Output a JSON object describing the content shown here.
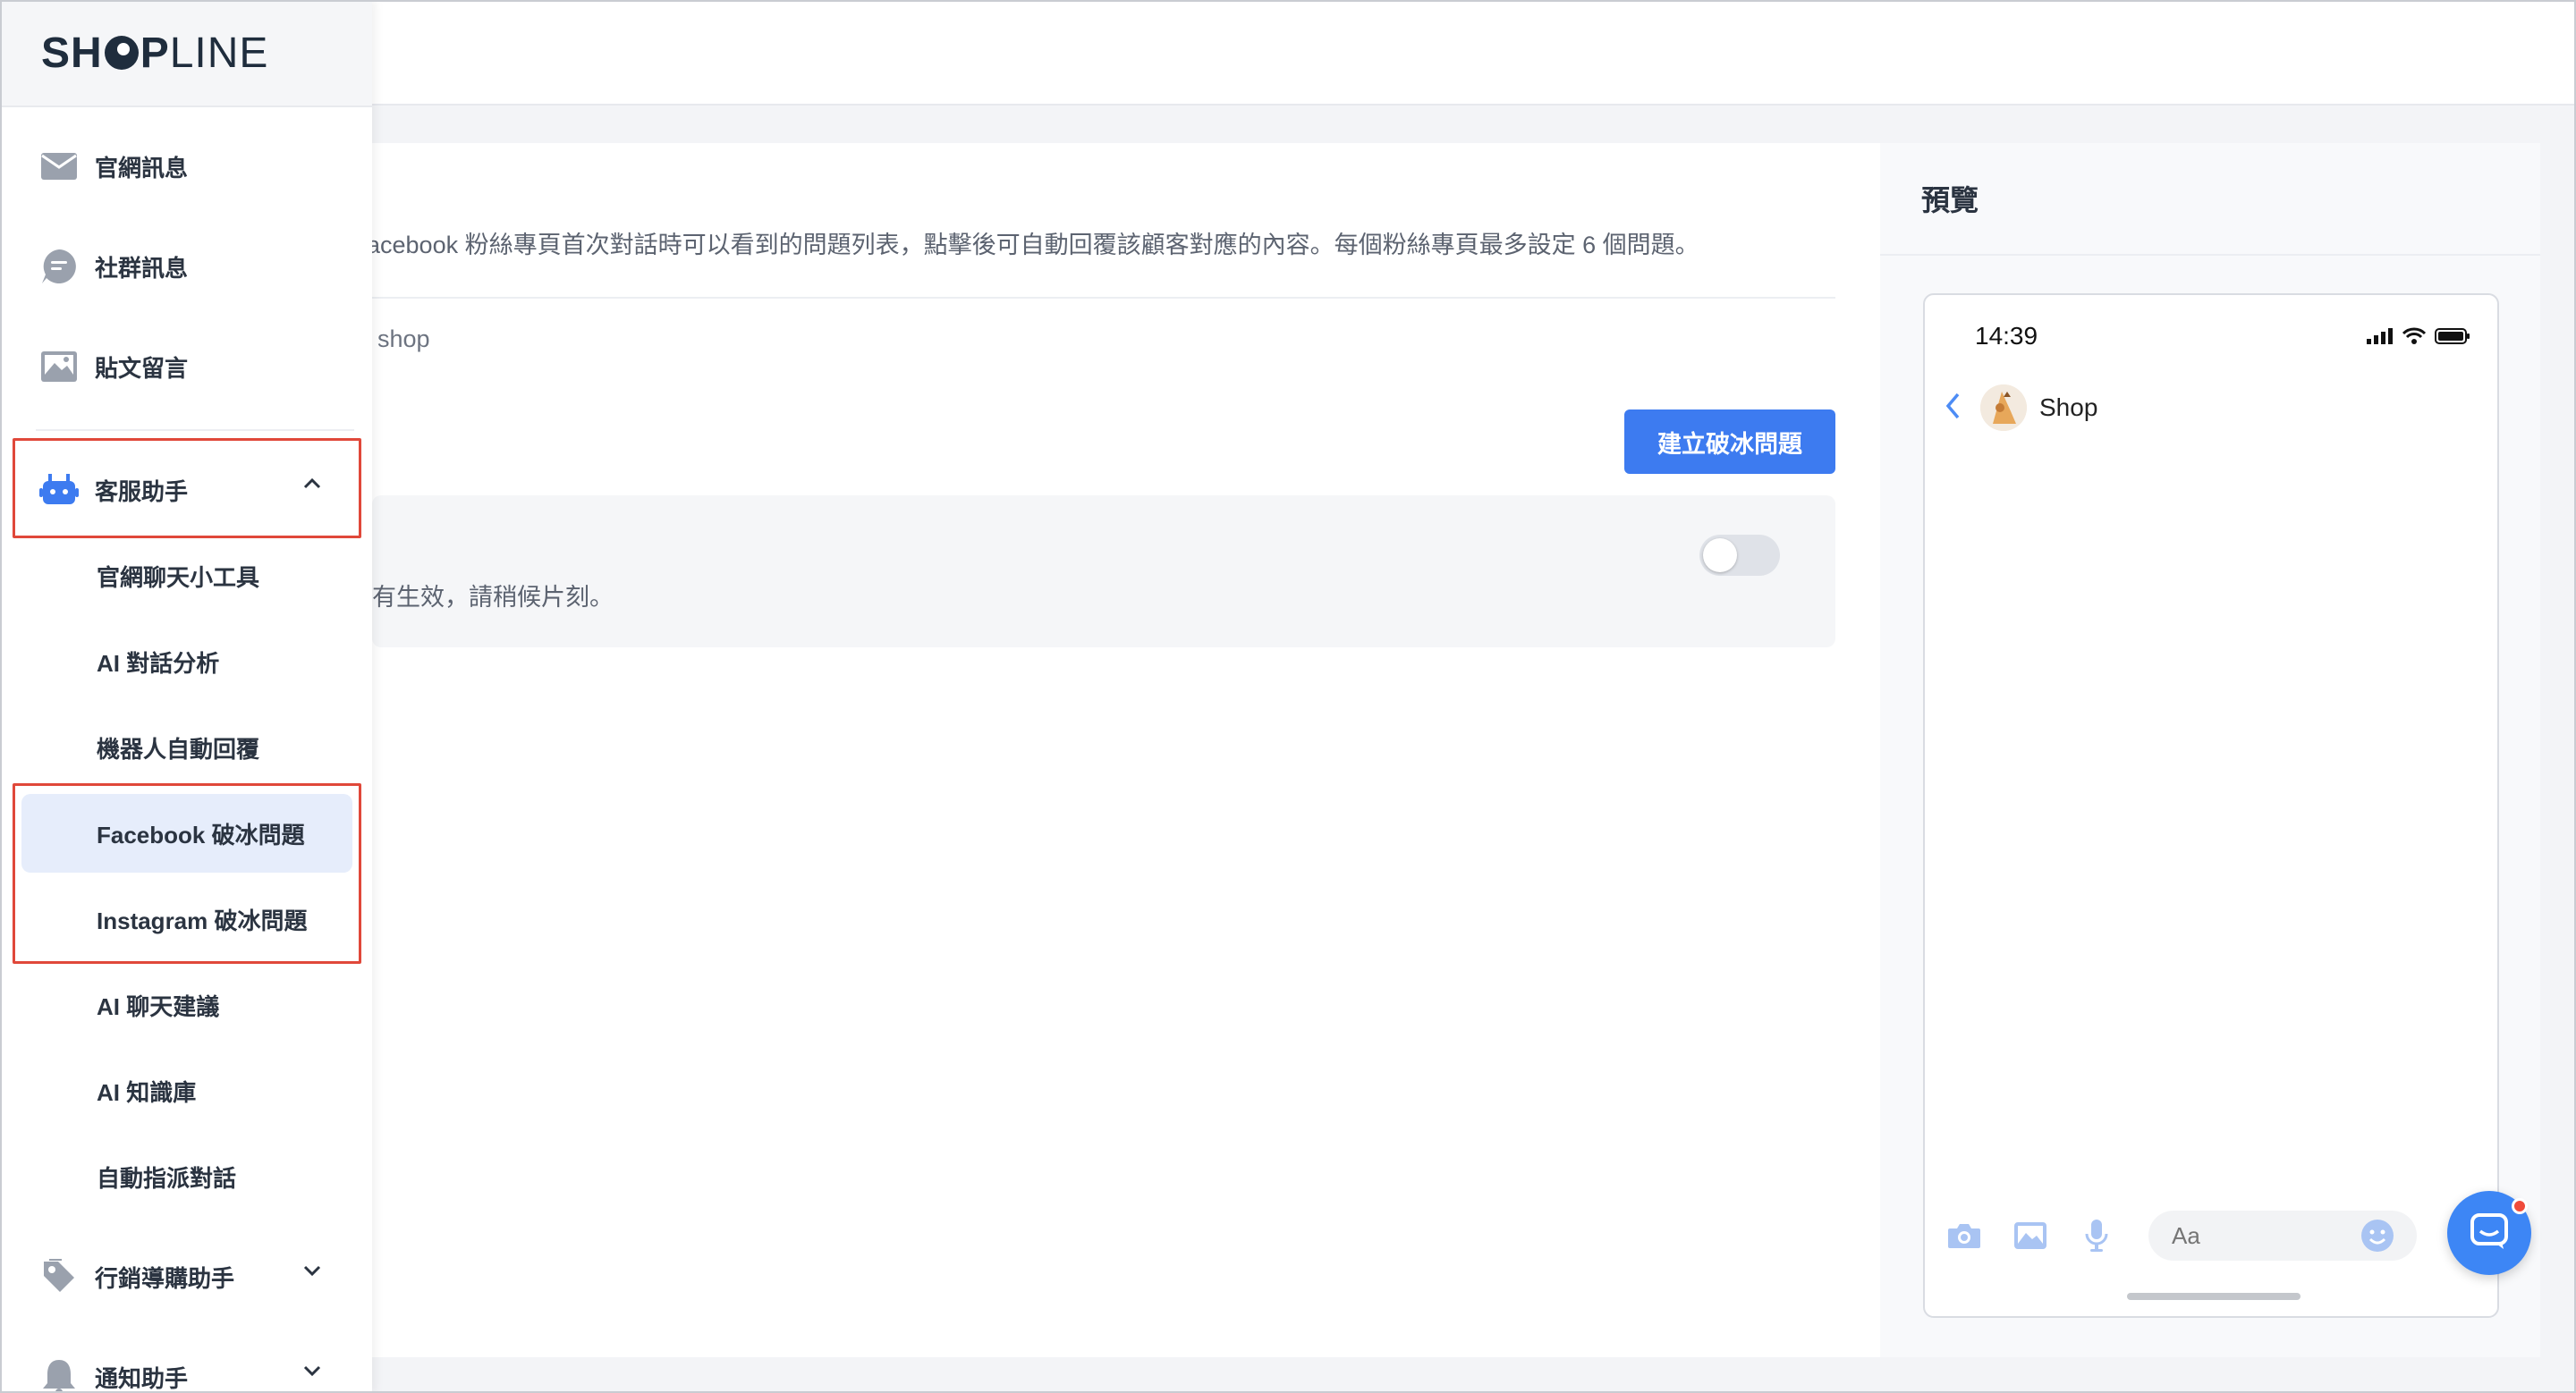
{
  "brand": {
    "logo_left": "SH",
    "logo_mid": "P",
    "logo_right": "LINE"
  },
  "sidebar": {
    "items": [
      {
        "label": "官網訊息",
        "icon": "mail-icon"
      },
      {
        "label": "社群訊息",
        "icon": "chat-bubble-icon"
      },
      {
        "label": "貼文留言",
        "icon": "image-icon"
      },
      {
        "label": "客服助手",
        "icon": "robot-icon",
        "expanded": true
      },
      {
        "label": "行銷導購助手",
        "icon": "tag-icon"
      },
      {
        "label": "通知助手",
        "icon": "bell-icon"
      }
    ],
    "sub_items": [
      {
        "label": "官網聊天小工具"
      },
      {
        "label": "AI 對話分析"
      },
      {
        "label": "機器人自動回覆"
      },
      {
        "label": "Facebook 破冰問題",
        "active": true
      },
      {
        "label": "Instagram 破冰問題"
      },
      {
        "label": "AI 聊天建議"
      },
      {
        "label": "AI 知識庫"
      },
      {
        "label": "自動指派對話"
      }
    ]
  },
  "main": {
    "description": "acebook 粉絲專頁首次對話時可以看到的問題列表，點擊後可自動回覆該顧客對應的內容。每個粉絲專頁最多設定 6 個問題。",
    "shop_text": "shop",
    "create_button": "建立破冰問題",
    "toggle_hint": "有生效，請稍候片刻。",
    "toggle_on": false
  },
  "preview": {
    "title": "預覽",
    "time": "14:39",
    "chat_name": "Shop",
    "input_placeholder": "Aa"
  },
  "colors": {
    "accent": "#3d7bf0",
    "highlight_box": "#e0483a",
    "active_bg": "#e6edfb",
    "notification_dot": "#ef4b3b"
  }
}
